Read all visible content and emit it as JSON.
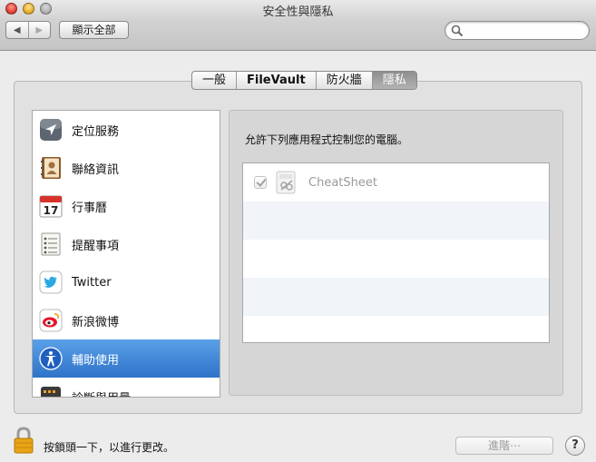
{
  "window": {
    "title": "安全性與隱私"
  },
  "toolbar": {
    "back_label": "◀",
    "forward_label": "▶",
    "show_all_label": "顯示全部",
    "search_placeholder": ""
  },
  "tabs": [
    {
      "label": "一般"
    },
    {
      "label": "FileVault"
    },
    {
      "label": "防火牆"
    },
    {
      "label": "隱私",
      "selected": true
    }
  ],
  "sidebar": {
    "items": [
      {
        "label": "定位服務",
        "icon": "location-arrow-icon"
      },
      {
        "label": "聯絡資訊",
        "icon": "contacts-book-icon"
      },
      {
        "label": "行事曆",
        "icon": "calendar-icon",
        "icon_text": "17"
      },
      {
        "label": "提醒事項",
        "icon": "reminders-icon"
      },
      {
        "label": "Twitter",
        "icon": "twitter-bird-icon"
      },
      {
        "label": "新浪微博",
        "icon": "sina-weibo-icon"
      },
      {
        "label": "輔助使用",
        "icon": "accessibility-icon",
        "selected": true
      },
      {
        "label": "診斷與用量",
        "icon": "diagnostics-icon"
      }
    ]
  },
  "main": {
    "description": "允許下列應用程式控制您的電腦。",
    "apps": [
      {
        "name": "CheatSheet",
        "checked": true,
        "icon": "cheatsheet-app-icon"
      }
    ]
  },
  "footer": {
    "lock_text": "按鎖頭一下，以進行更改。",
    "advanced_label": "進階⋯",
    "help_label": "?"
  },
  "colors": {
    "selection": "#2f73c9",
    "lock": "#e8a317"
  }
}
